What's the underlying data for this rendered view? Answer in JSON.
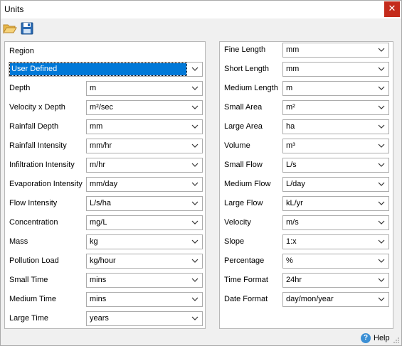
{
  "window": {
    "title": "Units"
  },
  "toolbar": {
    "open_icon": "folder-open-icon",
    "save_icon": "save-icon"
  },
  "left": {
    "region_label": "Region",
    "region_value": "User Defined",
    "rows": [
      {
        "label": "Depth",
        "value": "m"
      },
      {
        "label": "Velocity x Depth",
        "value": "m²/sec"
      },
      {
        "label": "Rainfall Depth",
        "value": "mm"
      },
      {
        "label": "Rainfall Intensity",
        "value": "mm/hr"
      },
      {
        "label": "Infiltration Intensity",
        "value": "m/hr"
      },
      {
        "label": "Evaporation Intensity",
        "value": "mm/day"
      },
      {
        "label": "Flow Intensity",
        "value": "L/s/ha"
      },
      {
        "label": "Concentration",
        "value": "mg/L"
      },
      {
        "label": "Mass",
        "value": "kg"
      },
      {
        "label": "Pollution Load",
        "value": "kg/hour"
      },
      {
        "label": "Small Time",
        "value": "mins"
      },
      {
        "label": "Medium Time",
        "value": "mins"
      },
      {
        "label": "Large Time",
        "value": "years"
      }
    ]
  },
  "right": {
    "rows": [
      {
        "label": "Fine Length",
        "value": "mm"
      },
      {
        "label": "Short Length",
        "value": "mm"
      },
      {
        "label": "Medium Length",
        "value": "m"
      },
      {
        "label": "Small Area",
        "value": "m²"
      },
      {
        "label": "Large Area",
        "value": "ha"
      },
      {
        "label": "Volume",
        "value": "m³"
      },
      {
        "label": "Small Flow",
        "value": "L/s"
      },
      {
        "label": "Medium Flow",
        "value": "L/day"
      },
      {
        "label": "Large Flow",
        "value": "kL/yr"
      },
      {
        "label": "Velocity",
        "value": "m/s"
      },
      {
        "label": "Slope",
        "value": "1:x"
      },
      {
        "label": "Percentage",
        "value": "%"
      },
      {
        "label": "Time Format",
        "value": "24hr"
      },
      {
        "label": "Date Format",
        "value": "day/mon/year"
      }
    ]
  },
  "footer": {
    "help_label": "Help"
  },
  "colors": {
    "selection": "#0078d7",
    "close": "#c42b1c",
    "help": "#3b8fd4"
  }
}
